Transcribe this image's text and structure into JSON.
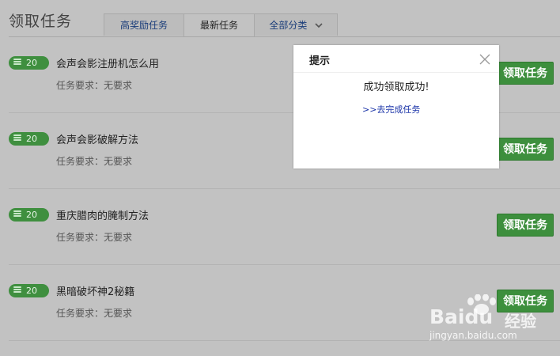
{
  "page": {
    "title": "领取任务"
  },
  "tabs": [
    {
      "label": "高奖励任务",
      "active": false
    },
    {
      "label": "最新任务",
      "active": true
    },
    {
      "label": "全部分类",
      "active": false,
      "icon": "chevron-down-icon"
    }
  ],
  "tasks": [
    {
      "reward": "20",
      "title": "会声会影注册机怎么用",
      "requirement": "任务要求：无要求",
      "button": "领取任务"
    },
    {
      "reward": "20",
      "title": "会声会影破解方法",
      "requirement": "任务要求：无要求",
      "button": "领取任务"
    },
    {
      "reward": "20",
      "title": "重庆腊肉的腌制方法",
      "requirement": "任务要求：无要求",
      "button": "领取任务"
    },
    {
      "reward": "20",
      "title": "黑暗破坏神2秘籍",
      "requirement": "任务要求：无要求",
      "button": "领取任务"
    }
  ],
  "modal": {
    "title": "提示",
    "message": "成功领取成功!",
    "link": ">>去完成任务"
  },
  "watermark": {
    "logo_prefix": "Bai",
    "logo_suffix": "u",
    "logo_cn": "经验",
    "url": "jingyan.baidu.com"
  },
  "colors": {
    "accent_green": "#3d8f3d",
    "overlay_gray": "#c2c2c2",
    "link_blue": "#1a33a8"
  }
}
